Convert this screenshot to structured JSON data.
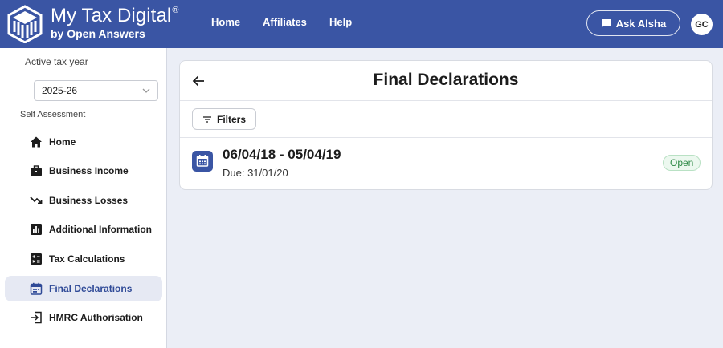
{
  "brand": {
    "title": "My Tax Digital",
    "registered": "®",
    "subtitle": "by Open Answers"
  },
  "nav": {
    "home": "Home",
    "affiliates": "Affiliates",
    "help": "Help"
  },
  "ask": {
    "label": "Ask Alsha"
  },
  "user": {
    "initials": "GC"
  },
  "sidebar": {
    "active_year_label": "Active tax year",
    "year": "2025-26",
    "section_label": "Self Assessment",
    "items": [
      {
        "label": "Home",
        "icon": "home-icon"
      },
      {
        "label": "Business Income",
        "icon": "briefcase-icon"
      },
      {
        "label": "Business Losses",
        "icon": "trending-down-icon"
      },
      {
        "label": "Additional Information",
        "icon": "bar-chart-icon"
      },
      {
        "label": "Tax Calculations",
        "icon": "calculator-icon"
      },
      {
        "label": "Final Declarations",
        "icon": "calendar-icon",
        "active": true
      },
      {
        "label": "HMRC Authorisation",
        "icon": "login-icon"
      }
    ]
  },
  "main": {
    "title": "Final Declarations",
    "filters_label": "Filters",
    "declarations": [
      {
        "period": "06/04/18 - 05/04/19",
        "due": "Due: 31/01/20",
        "status": "Open"
      }
    ]
  },
  "colors": {
    "header": "#3a55a4",
    "accent": "#2f4a97",
    "badge_green": "#2f8a47",
    "background": "#ebeef6"
  }
}
